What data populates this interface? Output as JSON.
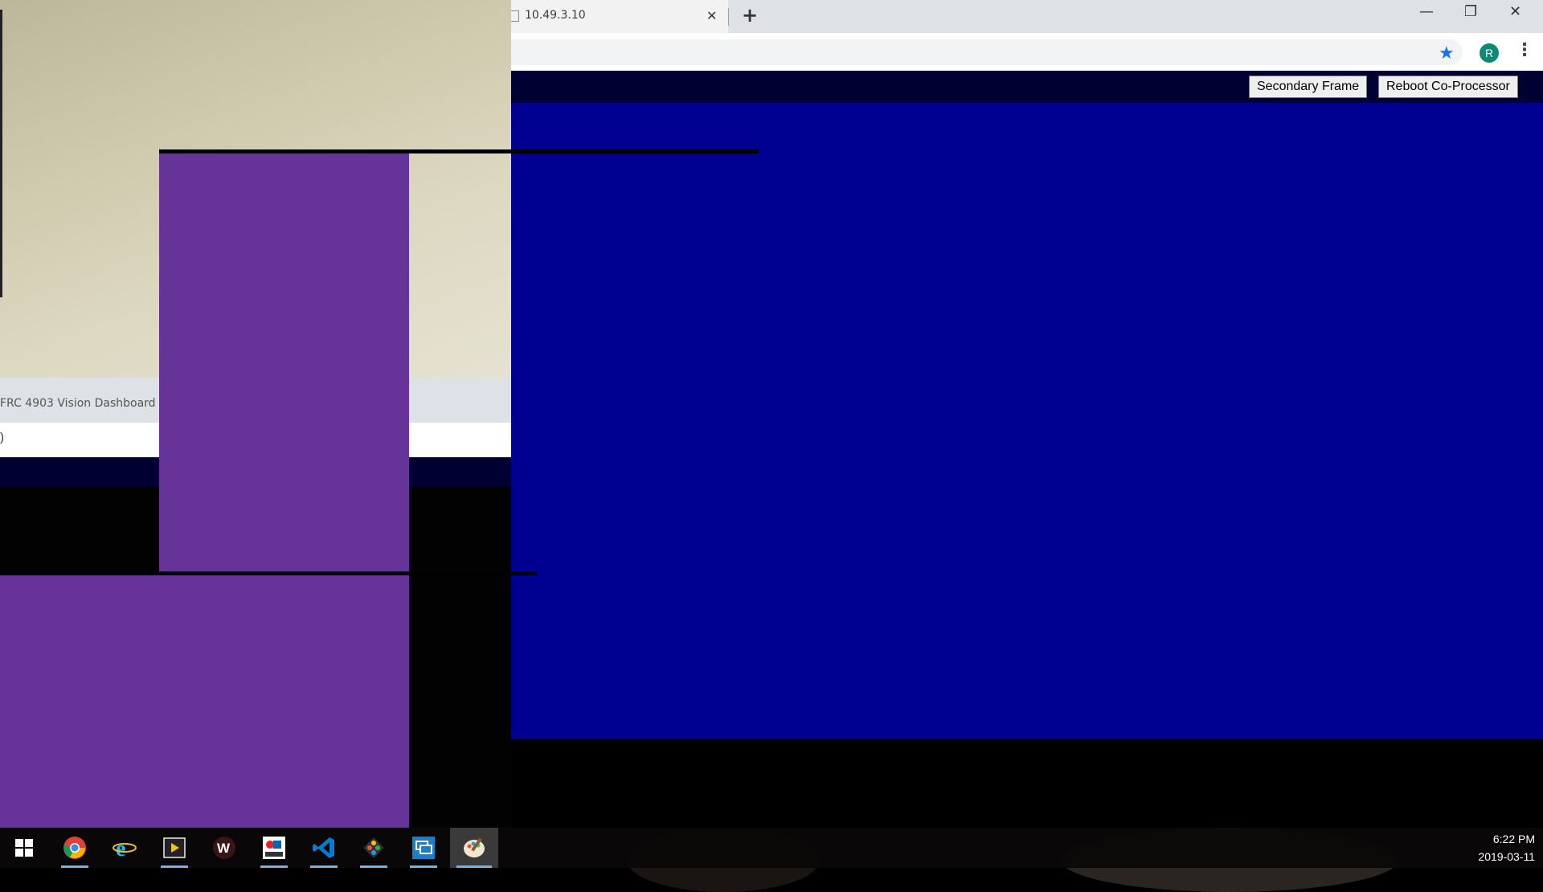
{
  "browser": {
    "tab_title": "10.49.3.10",
    "tab_close": "✕",
    "new_tab": "+",
    "window_controls": {
      "minimize": "—",
      "restore": "❐",
      "close": "✕"
    },
    "profile_initial": "R",
    "menu": "⋮",
    "bookmark_icon": "★"
  },
  "page": {
    "buttons": {
      "secondary_frame": "Secondary Frame",
      "reboot": "Reboot Co-Processor"
    },
    "colors": {
      "header": "#000033",
      "main": "#000090",
      "artifact": "#663399"
    }
  },
  "second_window": {
    "tab_title": "FRC 4903 Vision Dashboard",
    "address_fragment": ")"
  },
  "taskbar": {
    "apps": [
      "start-icon",
      "chrome-icon",
      "internet-explorer-icon",
      "media-player-icon",
      "word-icon",
      "frc-dashboard-icon",
      "vscode-icon",
      "git-icon",
      "remote-desktop-icon",
      "paint-icon"
    ],
    "time": "6:22 PM",
    "date": "2019-03-11"
  }
}
